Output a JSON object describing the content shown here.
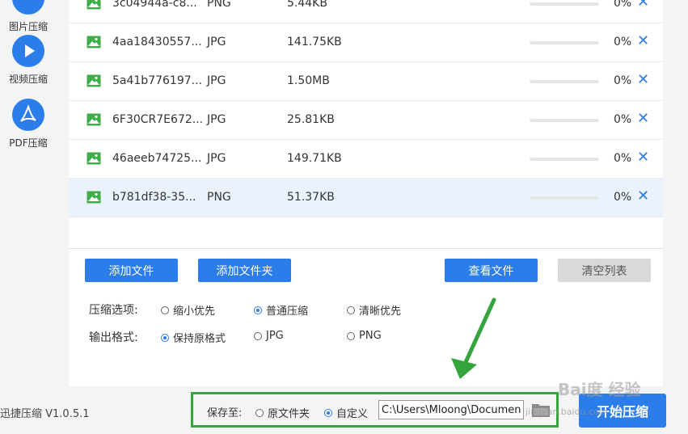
{
  "sidebar": {
    "items": [
      {
        "label": "图片压缩",
        "icon": "image-compress-icon"
      },
      {
        "label": "视频压缩",
        "icon": "play-icon"
      },
      {
        "label": "PDF压缩",
        "icon": "pdf-icon"
      }
    ]
  },
  "files": [
    {
      "name": "3c04944a-c8...",
      "type": "PNG",
      "size": "5.44KB",
      "progress": 0,
      "percent": "0%",
      "close": "✕"
    },
    {
      "name": "4aa18430557...",
      "type": "JPG",
      "size": "141.75KB",
      "progress": 0,
      "percent": "0%",
      "close": "✕"
    },
    {
      "name": "5a41b776197...",
      "type": "JPG",
      "size": "1.50MB",
      "progress": 0,
      "percent": "0%",
      "close": "✕"
    },
    {
      "name": "6F30CR7E672...",
      "type": "JPG",
      "size": "25.81KB",
      "progress": 0,
      "percent": "0%",
      "close": "✕"
    },
    {
      "name": "46aeeb74725...",
      "type": "JPG",
      "size": "149.71KB",
      "progress": 0,
      "percent": "0%",
      "close": "✕"
    },
    {
      "name": "b781df38-35...",
      "type": "PNG",
      "size": "51.37KB",
      "progress": 0,
      "percent": "0%",
      "close": "✕",
      "selected": true
    }
  ],
  "buttons": {
    "add_file": "添加文件",
    "add_folder": "添加文件夹",
    "view_files": "查看文件",
    "clear_list": "清空列表",
    "start": "开始压缩"
  },
  "compress_options": {
    "label": "压缩选项:",
    "options": [
      "缩小优先",
      "普通压缩",
      "清晰优先"
    ],
    "selected": 1
  },
  "output_format": {
    "label": "输出格式:",
    "options": [
      "保持原格式",
      "JPG",
      "PNG"
    ],
    "selected": 0
  },
  "save": {
    "label": "保存至:",
    "options": [
      "原文件夹",
      "自定义"
    ],
    "selected": 1,
    "path": "C:\\Users\\Mloong\\Documents"
  },
  "app": {
    "version": "迅捷压缩 V1.0.5.1"
  },
  "watermark": {
    "main": "Bai度 经验",
    "sub": "jingyan.baidu.com"
  },
  "colors": {
    "accent": "#2b7de9",
    "highlight": "#34a43c",
    "selected_row": "#eaf3fd"
  }
}
